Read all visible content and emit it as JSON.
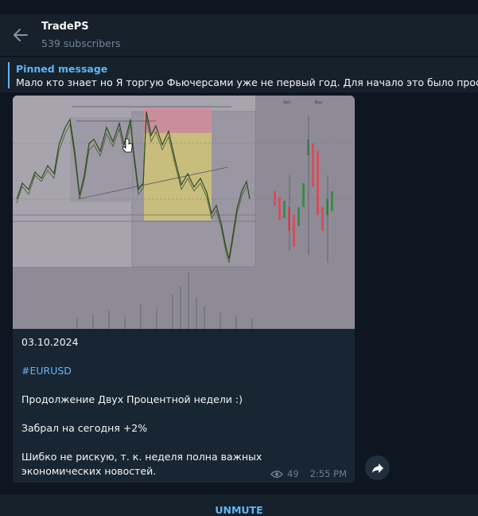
{
  "channel": {
    "title": "TradePS",
    "subscribers": "539 subscribers"
  },
  "pinned": {
    "title": "Pinned message",
    "text": "Мало кто знает но Я торгую Фьючерсами уже не первый год. Для начало это было просто ув"
  },
  "message": {
    "date_line": "03.10.2024",
    "hashtag": "#EURUSD",
    "line1": "Продолжение Двух Процентной недели :)",
    "line2": "Забрал на сегодня +2%",
    "line3": "Шибко не рискую, т. к. неделя полна важных экономических новостей.",
    "views": "49",
    "time": "2:55 PM",
    "chart_labels": {
      "left": "Sell",
      "right": "Buy"
    }
  },
  "bottom": {
    "unmute_label": "UNMUTE"
  },
  "colors": {
    "background": "#0e1621",
    "panel": "#17212b",
    "bubble": "#182533",
    "accent": "#5eb5f7",
    "muted_text": "#708499"
  },
  "icons": {
    "back": "arrow-left-icon",
    "views": "eye-icon",
    "forward": "share-arrow-icon"
  }
}
